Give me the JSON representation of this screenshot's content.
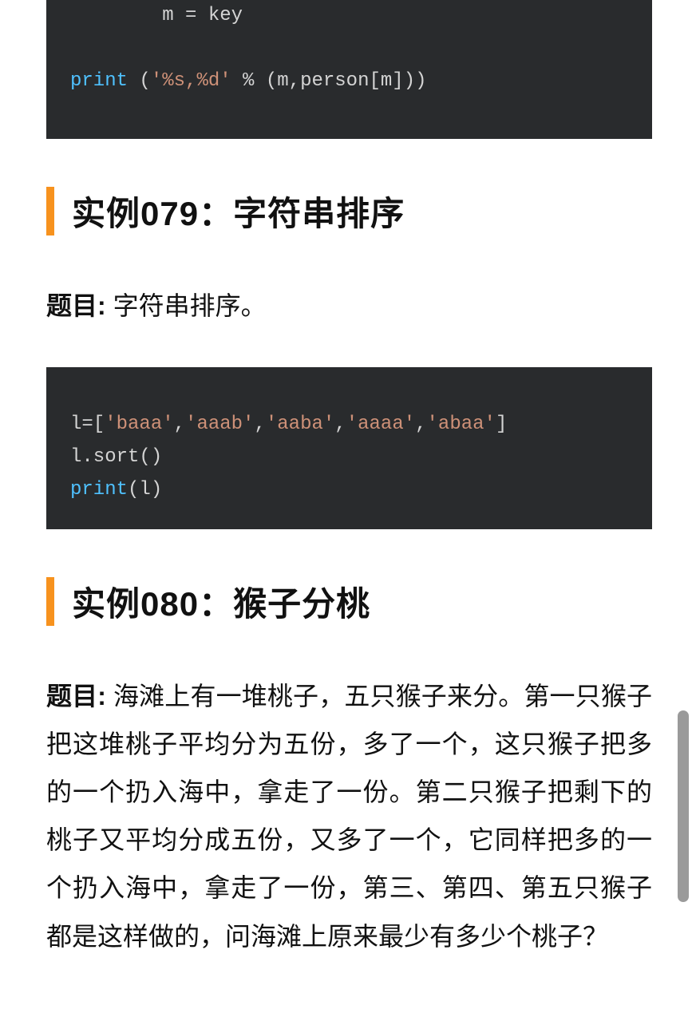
{
  "code1": {
    "line1_indent": "        ",
    "line1_text": "m = key",
    "line3_fn": "print",
    "line3_rest_a": " (",
    "line3_str": "'%s,%d'",
    "line3_rest_b": " % (m,person[m]))"
  },
  "section079": {
    "heading": "实例079：字符串排序",
    "prompt_label": "题目:",
    "prompt_text": " 字符串排序。"
  },
  "code2": {
    "line1_a": "l=[",
    "line1_s1": "'baaa'",
    "line1_c1": ",",
    "line1_s2": "'aaab'",
    "line1_c2": ",",
    "line1_s3": "'aaba'",
    "line1_c3": ",",
    "line1_s4": "'aaaa'",
    "line1_c4": ",",
    "line1_s5": "'abaa'",
    "line1_b": "]",
    "line2": "l.sort()",
    "line3_fn": "print",
    "line3_rest": "(l)"
  },
  "section080": {
    "heading": "实例080：猴子分桃",
    "prompt_label": "题目:",
    "prompt_text": " 海滩上有一堆桃子，五只猴子来分。第一只猴子把这堆桃子平均分为五份，多了一个，这只猴子把多的一个扔入海中，拿走了一份。第二只猴子把剩下的桃子又平均分成五份，又多了一个，它同样把多的一个扔入海中，拿走了一份，第三、第四、第五只猴子都是这样做的，问海滩上原来最少有多少个桃子？"
  }
}
